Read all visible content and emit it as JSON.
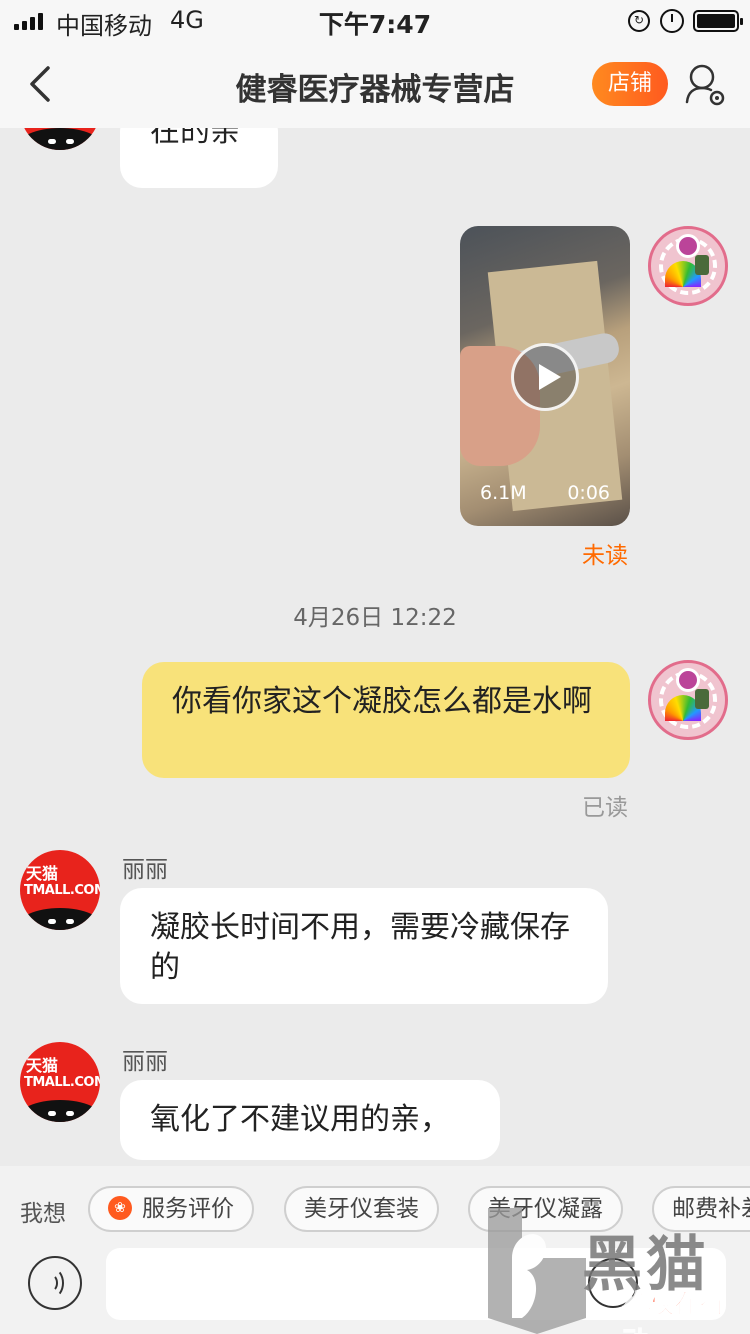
{
  "status_bar": {
    "carrier": "中国移动",
    "network": "4G",
    "time": "下午7:47"
  },
  "nav": {
    "title": "健睿医疗器械专营店",
    "store_button": "店铺"
  },
  "messages": {
    "m1": {
      "text": "在的亲"
    },
    "m2": {
      "video_size": "6.1M",
      "video_duration": "0:06",
      "status": "未读"
    },
    "date": "4月26日 12:22",
    "m3": {
      "text": "你看你家这个凝胶怎么都是水啊",
      "status": "已读"
    },
    "m4": {
      "sender": "丽丽",
      "avatar_text_1": "天猫",
      "avatar_text_2": "TMALL.COM",
      "text": "凝胶长时间不用，需要冷藏保存的"
    },
    "m5": {
      "sender": "丽丽",
      "avatar_text_1": "天猫",
      "avatar_text_2": "TMALL.COM",
      "text": "氧化了不建议用的亲，"
    }
  },
  "quick_replies": {
    "label": "我想",
    "items": [
      "服务评价",
      "美牙仪套装",
      "美牙仪凝露",
      "邮费补差"
    ]
  },
  "watermark": {
    "text": "维权在行动",
    "big": "黑猫"
  },
  "colors": {
    "accent": "#ff5a1f",
    "my_bubble": "#f8e27a",
    "unread": "#ff6a00",
    "tmall_red": "#e8231c"
  }
}
